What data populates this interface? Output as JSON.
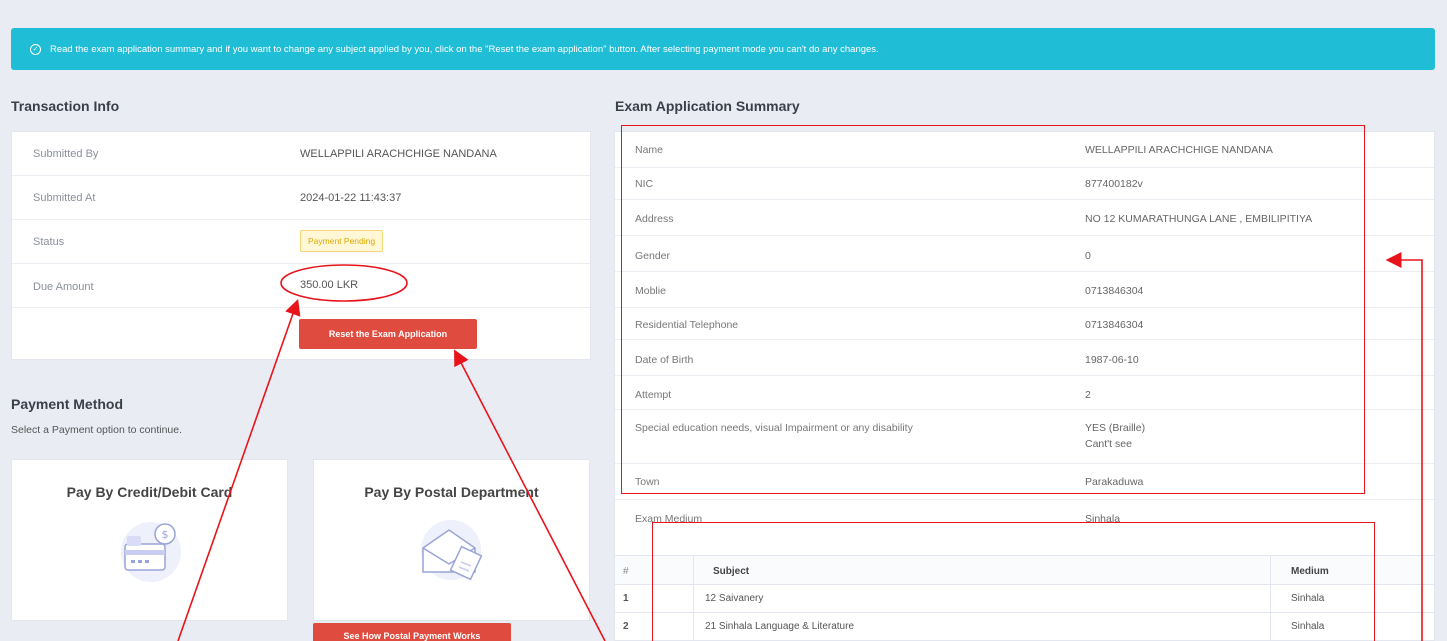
{
  "alert": {
    "message": "Read the exam application summary and if you want to change any subject applied by you, click on the \"Reset the exam application\" button. After selecting payment mode you can't do any changes."
  },
  "transaction": {
    "title": "Transaction Info",
    "submitted_by_label": "Submitted By",
    "submitted_by": "WELLAPPILI ARACHCHIGE NANDANA",
    "submitted_at_label": "Submitted At",
    "submitted_at": "2024-01-22 11:43:37",
    "status_label": "Status",
    "status": "Payment Pending",
    "due_label": "Due Amount",
    "due": "350.00 LKR",
    "reset_label": "Reset the Exam Application"
  },
  "payment": {
    "title": "Payment Method",
    "subtitle": "Select a Payment option to continue.",
    "card_label": "Pay By Credit/Debit Card",
    "postal_label": "Pay By Postal Department",
    "postal_button": "See How Postal Payment Works"
  },
  "summary": {
    "title": "Exam Application Summary",
    "rows": [
      {
        "label": "Name",
        "value": "WELLAPPILI ARACHCHIGE NANDANA"
      },
      {
        "label": "NIC",
        "value": "877400182v"
      },
      {
        "label": "Address",
        "value": "NO 12 KUMARATHUNGA LANE , EMBILIPITIYA"
      },
      {
        "label": "Gender",
        "value": "0"
      },
      {
        "label": "Moblie",
        "value": "0713846304"
      },
      {
        "label": "Residential Telephone",
        "value": "0713846304"
      },
      {
        "label": "Date of Birth",
        "value": "1987-06-10"
      },
      {
        "label": "Attempt",
        "value": "2"
      },
      {
        "label": "Special education needs, visual Impairment or any disability",
        "value": "YES (Braille)",
        "value2": "Cant't see"
      },
      {
        "label": "Town",
        "value": "Parakaduwa"
      },
      {
        "label": "Exam Medium",
        "value": "Sinhala"
      }
    ]
  },
  "subjects": {
    "headers": {
      "num": "#",
      "subject": "Subject",
      "medium": "Medium"
    },
    "rows": [
      {
        "num": "1",
        "subject": "12 Saivanery",
        "medium": "Sinhala"
      },
      {
        "num": "2",
        "subject": "21 Sinhala Language & Literature",
        "medium": "Sinhala"
      }
    ]
  },
  "colors": {
    "alert": "#1fbdd6",
    "danger": "#e04b3f",
    "annotation": "#e8141b",
    "warning": "#e0a800"
  }
}
